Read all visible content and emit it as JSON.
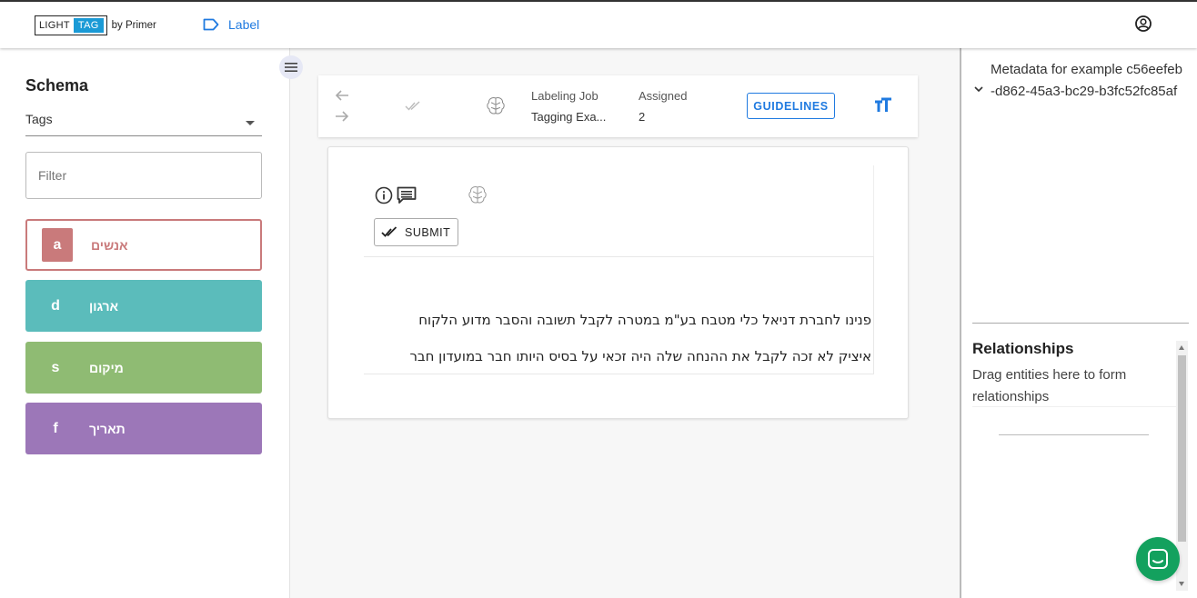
{
  "header": {
    "logo_light": "LIGHT",
    "logo_tag": "TAG",
    "logo_by": "by Primer",
    "nav_label": "Label",
    "icons": {
      "nav": "label-tag-icon",
      "account": "account-circle-icon"
    }
  },
  "sidebar": {
    "title": "Schema",
    "select_value": "Tags",
    "filter_placeholder": "Filter",
    "tags": [
      {
        "key": "a",
        "name": "אנשים",
        "color": "#c97a7b",
        "selected": true
      },
      {
        "key": "d",
        "name": "ארגון",
        "color": "#5bbcbb",
        "selected": false
      },
      {
        "key": "s",
        "name": "מיקום",
        "color": "#8fbb73",
        "selected": false
      },
      {
        "key": "f",
        "name": "תאריך",
        "color": "#9c77b8",
        "selected": false
      }
    ]
  },
  "toolbar": {
    "job_label": "Labeling Job",
    "job_value": "Tagging Exa...",
    "assigned_label": "Assigned",
    "assigned_value": "2",
    "guidelines_label": "GUIDELINES",
    "icons": [
      "arrow-left-icon",
      "arrow-right-icon",
      "done-all-icon",
      "brain-icon",
      "text-size-icon"
    ]
  },
  "example": {
    "submit_label": "SUBMIT",
    "text_lines": [
      "פנינו לחברת דניאל כלי מטבח בע\"מ במטרה לקבל תשובה והסבר מדוע הלקוח",
      "איציק לא זכה לקבל את ההנחה שלה היה זכאי על בסיס  היותו חבר במועדון חבר"
    ],
    "icons": [
      "info-icon",
      "comment-icon",
      "brain-icon",
      "done-all-icon"
    ]
  },
  "right_panel": {
    "metadata_text": "Metadata for example c56eefeb-d862-45a3-bc29-b3fc52fc85af",
    "relationships_title": "Relationships",
    "relationships_hint": "Drag entities here to form relationships",
    "accent_color": "#13a15e"
  }
}
